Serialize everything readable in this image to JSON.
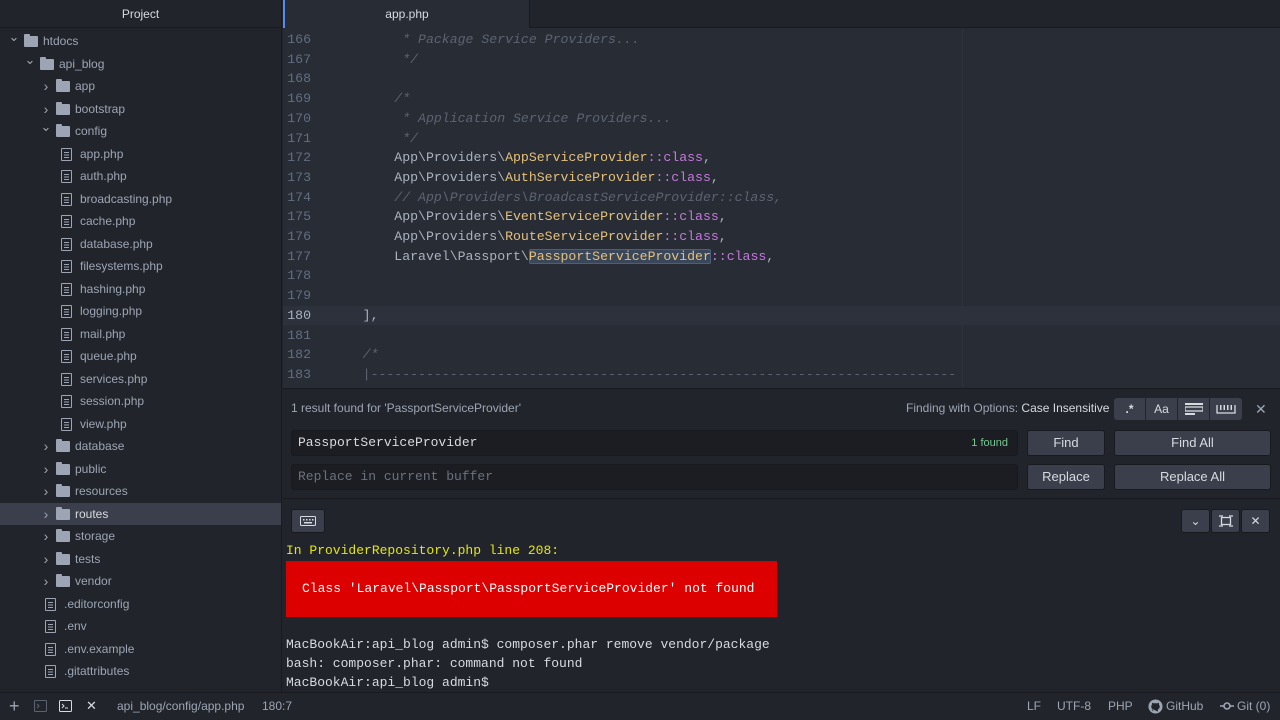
{
  "sidebar": {
    "title": "Project",
    "tree": [
      {
        "label": "htdocs",
        "type": "folder",
        "depth": 0,
        "expanded": true
      },
      {
        "label": "api_blog",
        "type": "folder",
        "depth": 1,
        "expanded": true
      },
      {
        "label": "app",
        "type": "folder",
        "depth": 2,
        "expanded": false
      },
      {
        "label": "bootstrap",
        "type": "folder",
        "depth": 2,
        "expanded": false
      },
      {
        "label": "config",
        "type": "folder",
        "depth": 2,
        "expanded": true
      },
      {
        "label": "app.php",
        "type": "file",
        "depth": 3
      },
      {
        "label": "auth.php",
        "type": "file",
        "depth": 3
      },
      {
        "label": "broadcasting.php",
        "type": "file",
        "depth": 3
      },
      {
        "label": "cache.php",
        "type": "file",
        "depth": 3
      },
      {
        "label": "database.php",
        "type": "file",
        "depth": 3
      },
      {
        "label": "filesystems.php",
        "type": "file",
        "depth": 3
      },
      {
        "label": "hashing.php",
        "type": "file",
        "depth": 3
      },
      {
        "label": "logging.php",
        "type": "file",
        "depth": 3
      },
      {
        "label": "mail.php",
        "type": "file",
        "depth": 3
      },
      {
        "label": "queue.php",
        "type": "file",
        "depth": 3
      },
      {
        "label": "services.php",
        "type": "file",
        "depth": 3
      },
      {
        "label": "session.php",
        "type": "file",
        "depth": 3
      },
      {
        "label": "view.php",
        "type": "file",
        "depth": 3
      },
      {
        "label": "database",
        "type": "folder",
        "depth": 2,
        "expanded": false
      },
      {
        "label": "public",
        "type": "folder",
        "depth": 2,
        "expanded": false
      },
      {
        "label": "resources",
        "type": "folder",
        "depth": 2,
        "expanded": false
      },
      {
        "label": "routes",
        "type": "folder",
        "depth": 2,
        "expanded": false,
        "selected": true
      },
      {
        "label": "storage",
        "type": "folder",
        "depth": 2,
        "expanded": false
      },
      {
        "label": "tests",
        "type": "folder",
        "depth": 2,
        "expanded": false
      },
      {
        "label": "vendor",
        "type": "folder",
        "depth": 2,
        "expanded": false
      },
      {
        "label": ".editorconfig",
        "type": "file",
        "depth": 2
      },
      {
        "label": ".env",
        "type": "file",
        "depth": 2
      },
      {
        "label": ".env.example",
        "type": "file",
        "depth": 2
      },
      {
        "label": ".gitattributes",
        "type": "file",
        "depth": 2
      }
    ]
  },
  "tabs": [
    {
      "label": "app.php",
      "active": true
    }
  ],
  "editor": {
    "cursor_line": "180",
    "lines": [
      {
        "n": "166",
        "segs": [
          {
            "t": "         * Package Service Providers...",
            "c": "cmt"
          }
        ]
      },
      {
        "n": "167",
        "segs": [
          {
            "t": "         */",
            "c": "cmt"
          }
        ]
      },
      {
        "n": "168",
        "segs": []
      },
      {
        "n": "169",
        "segs": [
          {
            "t": "        /*",
            "c": "cmt"
          }
        ]
      },
      {
        "n": "170",
        "segs": [
          {
            "t": "         * Application Service Providers...",
            "c": "cmt"
          }
        ]
      },
      {
        "n": "171",
        "segs": [
          {
            "t": "         */",
            "c": "cmt"
          }
        ]
      },
      {
        "n": "172",
        "segs": [
          {
            "t": "        App\\Providers\\",
            "c": ""
          },
          {
            "t": "AppServiceProvider",
            "c": "cls"
          },
          {
            "t": "::class",
            "c": "kw"
          },
          {
            "t": ",",
            "c": ""
          }
        ]
      },
      {
        "n": "173",
        "segs": [
          {
            "t": "        App\\Providers\\",
            "c": ""
          },
          {
            "t": "AuthServiceProvider",
            "c": "cls"
          },
          {
            "t": "::class",
            "c": "kw"
          },
          {
            "t": ",",
            "c": ""
          }
        ]
      },
      {
        "n": "174",
        "segs": [
          {
            "t": "        // App\\Providers\\BroadcastServiceProvider::class,",
            "c": "cmt"
          }
        ]
      },
      {
        "n": "175",
        "segs": [
          {
            "t": "        App\\Providers\\",
            "c": ""
          },
          {
            "t": "EventServiceProvider",
            "c": "cls"
          },
          {
            "t": "::class",
            "c": "kw"
          },
          {
            "t": ",",
            "c": ""
          }
        ]
      },
      {
        "n": "176",
        "segs": [
          {
            "t": "        App\\Providers\\",
            "c": ""
          },
          {
            "t": "RouteServiceProvider",
            "c": "cls"
          },
          {
            "t": "::class",
            "c": "kw"
          },
          {
            "t": ",",
            "c": ""
          }
        ]
      },
      {
        "n": "177",
        "segs": [
          {
            "t": "        Laravel\\Passport\\",
            "c": ""
          },
          {
            "t": "PassportServiceProvider",
            "c": "cls hl"
          },
          {
            "t": "::class",
            "c": "kw"
          },
          {
            "t": ",",
            "c": ""
          }
        ]
      },
      {
        "n": "178",
        "segs": []
      },
      {
        "n": "179",
        "segs": []
      },
      {
        "n": "180",
        "segs": [
          {
            "t": "    ],",
            "c": ""
          }
        ]
      },
      {
        "n": "181",
        "segs": []
      },
      {
        "n": "182",
        "segs": [
          {
            "t": "    /*",
            "c": "cmt"
          }
        ]
      },
      {
        "n": "183",
        "segs": [
          {
            "t": "    |--------------------------------------------------------------------------",
            "c": "cmt"
          }
        ]
      }
    ]
  },
  "find": {
    "status": "1 result found for 'PassportServiceProvider'",
    "options_label": "Finding with Options:",
    "options_value": "Case Insensitive",
    "option_buttons": [
      ".*",
      "Aa",
      "≡",
      "▭"
    ],
    "query": "PassportServiceProvider",
    "count": "1 found",
    "replace_placeholder": "Replace in current buffer",
    "find_label": "Find",
    "find_all_label": "Find All",
    "replace_label": "Replace",
    "replace_all_label": "Replace All"
  },
  "terminal": {
    "warn_line": "In ProviderRepository.php line 208:",
    "error_text": "Class 'Laravel\\Passport\\PassportServiceProvider' not found",
    "lines": [
      "MacBookAir:api_blog admin$ composer.phar remove vendor/package",
      "bash: composer.phar: command not found",
      "MacBookAir:api_blog admin$"
    ]
  },
  "statusbar": {
    "path": "api_blog/config/app.php",
    "cursor": "180:7",
    "line_ending": "LF",
    "encoding": "UTF-8",
    "grammar": "PHP",
    "github": "GitHub",
    "git": "Git (0)"
  },
  "colors": {
    "accent": "#568af2",
    "error_bg": "#dd0000",
    "found_green": "#73c990",
    "warn_yellow": "#e5e510"
  }
}
